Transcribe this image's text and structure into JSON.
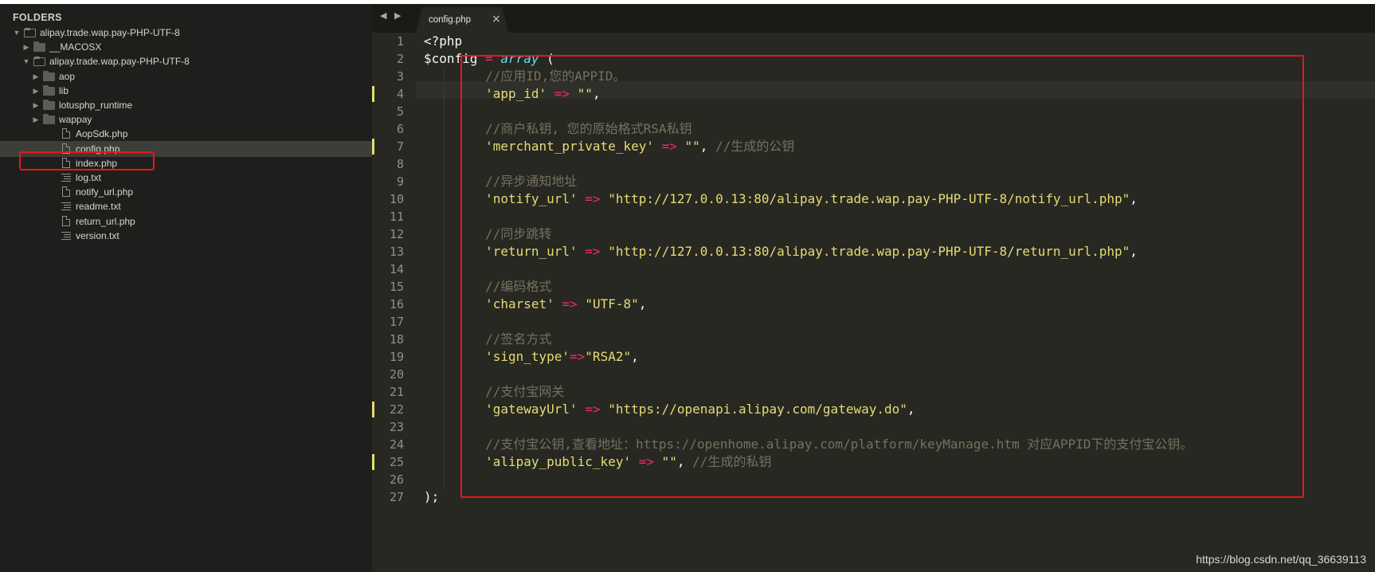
{
  "sidebar": {
    "header": "FOLDERS",
    "tree": [
      {
        "label": "alipay.trade.wap.pay-PHP-UTF-8",
        "kind": "folder-open",
        "depth": 0,
        "arrow": "▼"
      },
      {
        "label": "__MACOSX",
        "kind": "folder",
        "depth": 1,
        "arrow": "▶"
      },
      {
        "label": "alipay.trade.wap.pay-PHP-UTF-8",
        "kind": "folder-open",
        "depth": 1,
        "arrow": "▼"
      },
      {
        "label": "aop",
        "kind": "folder",
        "depth": 2,
        "arrow": "▶"
      },
      {
        "label": "lib",
        "kind": "folder",
        "depth": 2,
        "arrow": "▶"
      },
      {
        "label": "lotusphp_runtime",
        "kind": "folder",
        "depth": 2,
        "arrow": "▶"
      },
      {
        "label": "wappay",
        "kind": "folder",
        "depth": 2,
        "arrow": "▶"
      },
      {
        "label": "AopSdk.php",
        "kind": "file",
        "depth": 2
      },
      {
        "label": "config.php",
        "kind": "file",
        "depth": 2,
        "selected": true
      },
      {
        "label": "index.php",
        "kind": "file",
        "depth": 2
      },
      {
        "label": "log.txt",
        "kind": "text",
        "depth": 2
      },
      {
        "label": "notify_url.php",
        "kind": "file",
        "depth": 2
      },
      {
        "label": "readme.txt",
        "kind": "text",
        "depth": 2
      },
      {
        "label": "return_url.php",
        "kind": "file",
        "depth": 2
      },
      {
        "label": "version.txt",
        "kind": "text",
        "depth": 2
      }
    ]
  },
  "tabbar": {
    "nav_prev": "◀",
    "nav_next": "▶",
    "active_tab": "config.php",
    "close_glyph": "×"
  },
  "editor": {
    "modified_lines": [
      4,
      7,
      22,
      25
    ],
    "current_line": 2,
    "lines": [
      [
        [
          "pl",
          "<?php"
        ]
      ],
      [
        [
          "pl",
          "$config "
        ],
        [
          "op",
          "="
        ],
        [
          "pl",
          " "
        ],
        [
          "fn",
          "array"
        ],
        [
          "pl",
          " ("
        ]
      ],
      [
        [
          "pl",
          "        "
        ],
        [
          "cm",
          "//应用ID,您的APPID。"
        ]
      ],
      [
        [
          "pl",
          "        "
        ],
        [
          "str",
          "'app_id'"
        ],
        [
          "pl",
          " "
        ],
        [
          "op",
          "=>"
        ],
        [
          "pl",
          " "
        ],
        [
          "str",
          "\"\""
        ],
        [
          "pl",
          ","
        ]
      ],
      [
        [
          "pl",
          ""
        ]
      ],
      [
        [
          "pl",
          "        "
        ],
        [
          "cm",
          "//商户私钥, 您的原始格式RSA私钥"
        ]
      ],
      [
        [
          "pl",
          "        "
        ],
        [
          "str",
          "'merchant_private_key'"
        ],
        [
          "pl",
          " "
        ],
        [
          "op",
          "=>"
        ],
        [
          "pl",
          " "
        ],
        [
          "str",
          "\"\""
        ],
        [
          "pl",
          ", "
        ],
        [
          "cm",
          "//生成的公钥"
        ]
      ],
      [
        [
          "pl",
          ""
        ]
      ],
      [
        [
          "pl",
          "        "
        ],
        [
          "cm",
          "//异步通知地址"
        ]
      ],
      [
        [
          "pl",
          "        "
        ],
        [
          "str",
          "'notify_url'"
        ],
        [
          "pl",
          " "
        ],
        [
          "op",
          "=>"
        ],
        [
          "pl",
          " "
        ],
        [
          "str",
          "\"http://127.0.0.13:80/alipay.trade.wap.pay-PHP-UTF-8/notify_url.php\""
        ],
        [
          "pl",
          ","
        ]
      ],
      [
        [
          "pl",
          ""
        ]
      ],
      [
        [
          "pl",
          "        "
        ],
        [
          "cm",
          "//同步跳转"
        ]
      ],
      [
        [
          "pl",
          "        "
        ],
        [
          "str",
          "'return_url'"
        ],
        [
          "pl",
          " "
        ],
        [
          "op",
          "=>"
        ],
        [
          "pl",
          " "
        ],
        [
          "str",
          "\"http://127.0.0.13:80/alipay.trade.wap.pay-PHP-UTF-8/return_url.php\""
        ],
        [
          "pl",
          ","
        ]
      ],
      [
        [
          "pl",
          ""
        ]
      ],
      [
        [
          "pl",
          "        "
        ],
        [
          "cm",
          "//编码格式"
        ]
      ],
      [
        [
          "pl",
          "        "
        ],
        [
          "str",
          "'charset'"
        ],
        [
          "pl",
          " "
        ],
        [
          "op",
          "=>"
        ],
        [
          "pl",
          " "
        ],
        [
          "str",
          "\"UTF-8\""
        ],
        [
          "pl",
          ","
        ]
      ],
      [
        [
          "pl",
          ""
        ]
      ],
      [
        [
          "pl",
          "        "
        ],
        [
          "cm",
          "//签名方式"
        ]
      ],
      [
        [
          "pl",
          "        "
        ],
        [
          "str",
          "'sign_type'"
        ],
        [
          "op",
          "=>"
        ],
        [
          "str",
          "\"RSA2\""
        ],
        [
          "pl",
          ","
        ]
      ],
      [
        [
          "pl",
          ""
        ]
      ],
      [
        [
          "pl",
          "        "
        ],
        [
          "cm",
          "//支付宝网关"
        ]
      ],
      [
        [
          "pl",
          "        "
        ],
        [
          "str",
          "'gatewayUrl'"
        ],
        [
          "pl",
          " "
        ],
        [
          "op",
          "=>"
        ],
        [
          "pl",
          " "
        ],
        [
          "str",
          "\"https://openapi.alipay.com/gateway.do\""
        ],
        [
          "pl",
          ","
        ]
      ],
      [
        [
          "pl",
          ""
        ]
      ],
      [
        [
          "pl",
          "        "
        ],
        [
          "cm",
          "//支付宝公钥,查看地址：https://openhome.alipay.com/platform/keyManage.htm 对应APPID下的支付宝公钥。"
        ]
      ],
      [
        [
          "pl",
          "        "
        ],
        [
          "str",
          "'alipay_public_key'"
        ],
        [
          "pl",
          " "
        ],
        [
          "op",
          "=>"
        ],
        [
          "pl",
          " "
        ],
        [
          "str",
          "\"\""
        ],
        [
          "pl",
          ", "
        ],
        [
          "cm",
          "//生成的私钥"
        ]
      ],
      [
        [
          "pl",
          ""
        ]
      ],
      [
        [
          "pl",
          ");"
        ]
      ]
    ]
  },
  "colors": {
    "editor_bg": "#272822",
    "sidebar_bg": "#1e1f1c",
    "keyword": "#f92672",
    "string": "#e6db74",
    "comment": "#75715e",
    "function": "#66d9ef",
    "highlight_box": "#e8161c"
  },
  "watermark": "https://blog.csdn.net/qq_36639113"
}
